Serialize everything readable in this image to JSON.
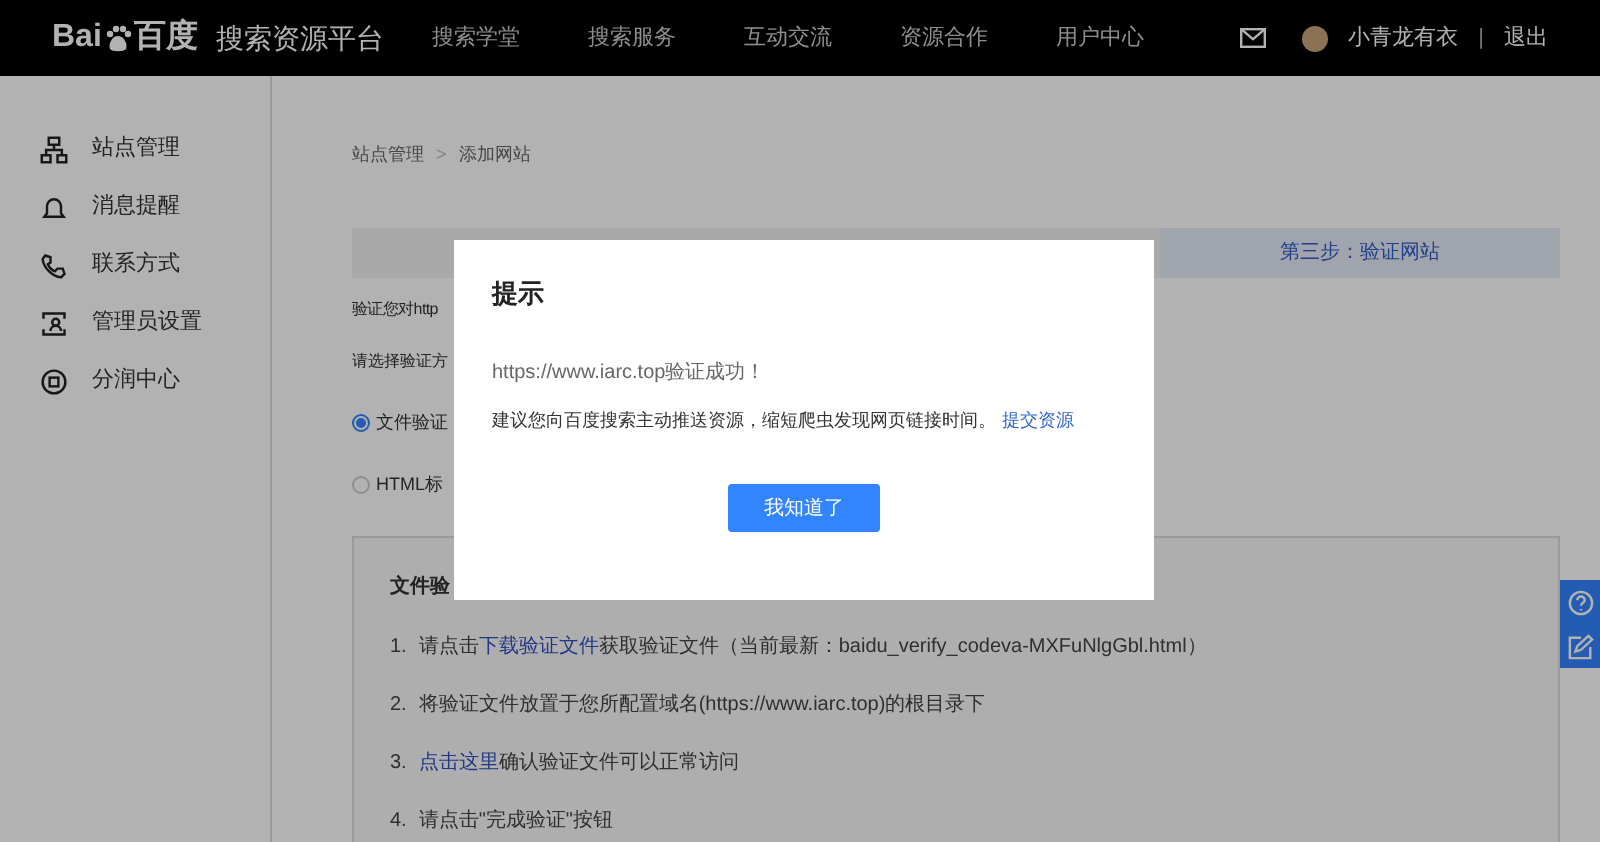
{
  "header": {
    "logo_left": "Bai",
    "logo_right": "百度",
    "platform": "搜索资源平台",
    "nav": [
      {
        "label": "搜索学堂"
      },
      {
        "label": "搜索服务"
      },
      {
        "label": "互动交流"
      },
      {
        "label": "资源合作"
      },
      {
        "label": "用户中心"
      }
    ],
    "username": "小青龙有衣",
    "separator": "|",
    "logout": "退出"
  },
  "sidebar": {
    "items": [
      {
        "label": "站点管理"
      },
      {
        "label": "消息提醒"
      },
      {
        "label": "联系方式"
      },
      {
        "label": "管理员设置"
      },
      {
        "label": "分润中心"
      }
    ]
  },
  "breadcrumb": {
    "items": [
      "站点管理",
      "添加网站"
    ],
    "separator": ">"
  },
  "steps": [
    {
      "label": "第三步：验证网站",
      "selected": true
    }
  ],
  "verify_intro": "验证您对http",
  "method_prompt": "请选择验证方",
  "methods": [
    {
      "label": "文件验证",
      "selected": true
    },
    {
      "label": "HTML标",
      "selected": false
    }
  ],
  "file_box": {
    "title": "文件验",
    "steps": [
      {
        "number": "1.",
        "parts": [
          {
            "kind": "text",
            "text": "请点击"
          },
          {
            "kind": "link",
            "text": "下载验证文件"
          },
          {
            "kind": "text",
            "text": "获取验证文件（当前最新：baidu_verify_codeva-MXFuNlgGbl.html）"
          }
        ]
      },
      {
        "number": "2.",
        "parts": [
          {
            "kind": "text",
            "text": "将验证文件放置于您所配置域名(https://www.iarc.top)的根目录下"
          }
        ]
      },
      {
        "number": "3.",
        "parts": [
          {
            "kind": "link",
            "text": "点击这里"
          },
          {
            "kind": "text",
            "text": "确认验证文件可以正常访问"
          }
        ]
      },
      {
        "number": "4.",
        "parts": [
          {
            "kind": "text",
            "text": "请点击\"完成验证\"按钮"
          }
        ]
      }
    ]
  },
  "dialog": {
    "title": "提示",
    "message": "https://www.iarc.top验证成功！",
    "suggestion": "建议您向百度搜索主动推送资源，缩短爬虫发现网页链接时间。",
    "link": "提交资源",
    "button": "我知道了"
  }
}
